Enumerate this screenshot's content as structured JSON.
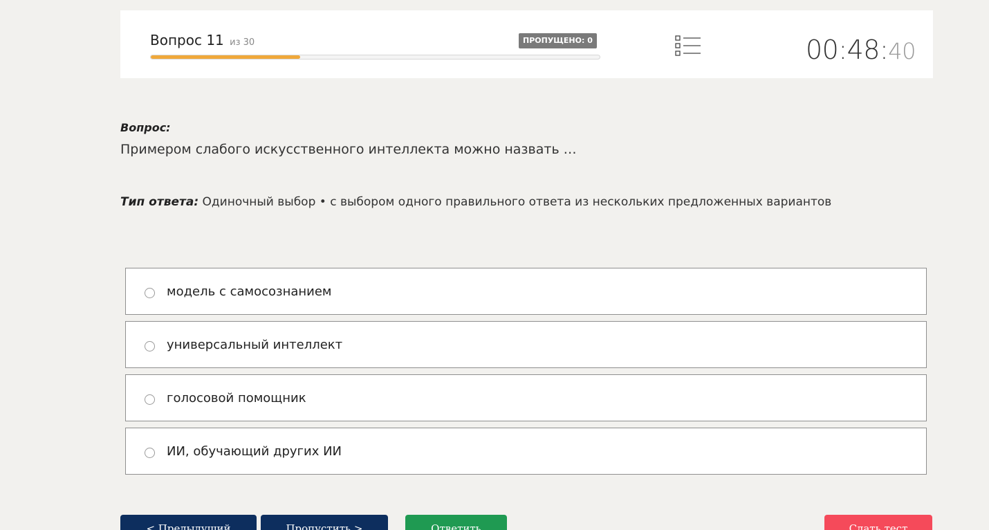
{
  "header": {
    "question_label": "Вопрос 11",
    "question_total": "из 30",
    "progress_fraction": 0.3333,
    "skipped_badge": "ПРОПУЩЕНО: 0",
    "list_icon": "list-icon",
    "timer": {
      "main": "00:48:",
      "seconds": "40"
    }
  },
  "question": {
    "label": "Вопрос:",
    "text": "Примером слабого искусственного интеллекта можно назвать …",
    "answer_type_label": "Тип ответа:",
    "answer_type_value": " Одиночный выбор • с выбором одного правильного ответа из нескольких предложенных вариантов"
  },
  "options": [
    {
      "label": "модель с самосознанием"
    },
    {
      "label": "универсальный интеллект"
    },
    {
      "label": "голосовой помощник"
    },
    {
      "label": "ИИ, обучающий других ИИ"
    }
  ],
  "buttons": {
    "prev": "< Предыдущий",
    "skip": "Пропустить >",
    "answer": "Ответить",
    "submit": "Сдать тест"
  },
  "colors": {
    "progress": "#f0a83a",
    "nav_button": "#0d2e5e",
    "answer_button": "#1f9a52",
    "submit_button": "#f54a5a"
  }
}
